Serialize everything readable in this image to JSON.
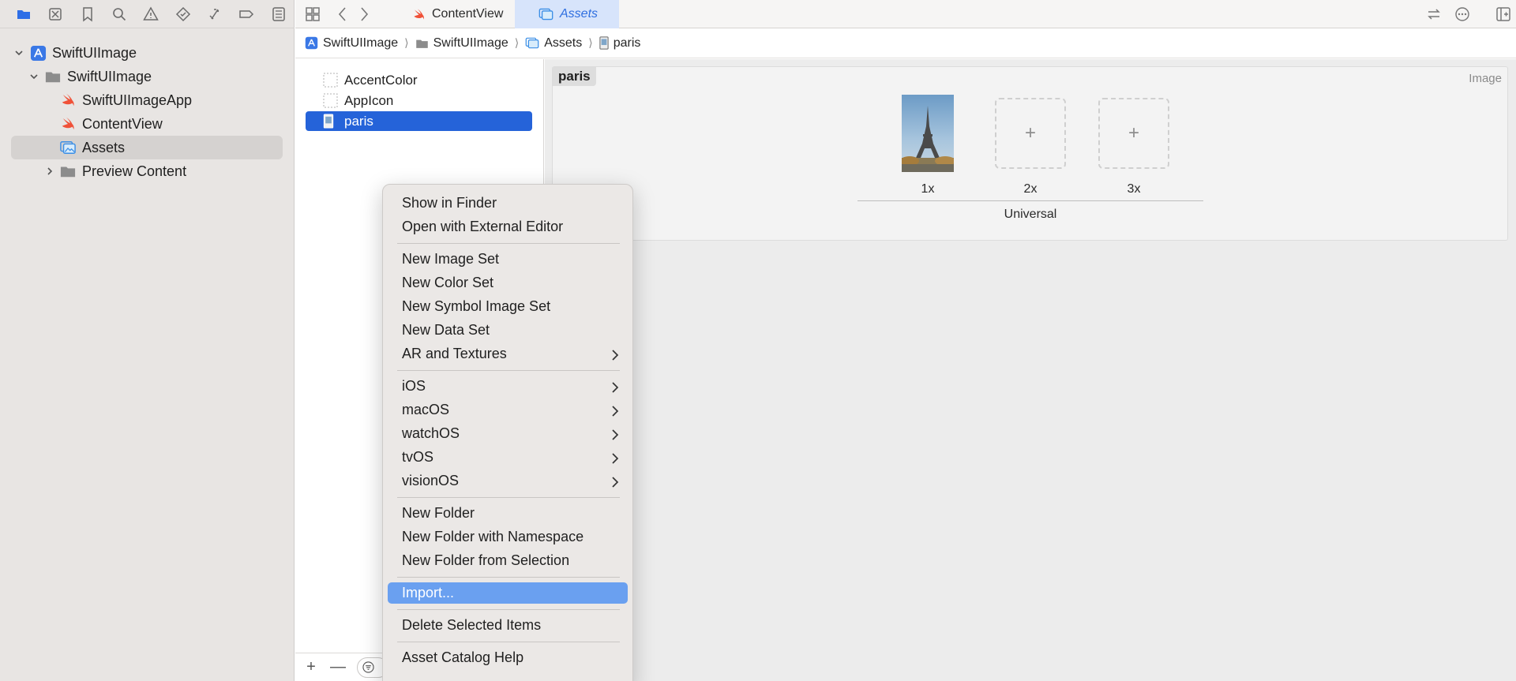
{
  "navigator": {
    "toolbar": [
      "folder-icon",
      "source-control-icon",
      "bookmark-icon",
      "search-icon",
      "warning-icon",
      "test-diamond-icon",
      "debug-icon",
      "breakpoint-icon",
      "report-icon"
    ],
    "tree": [
      {
        "label": "SwiftUIImage",
        "icon": "app-project-icon",
        "level": 0,
        "expanded": true
      },
      {
        "label": "SwiftUIImage",
        "icon": "folder-icon",
        "level": 1,
        "expanded": true
      },
      {
        "label": "SwiftUIImageApp",
        "icon": "swift-icon",
        "level": 2
      },
      {
        "label": "ContentView",
        "icon": "swift-icon",
        "level": 2
      },
      {
        "label": "Assets",
        "icon": "asset-catalog-icon",
        "level": 2,
        "selected": true
      },
      {
        "label": "Preview Content",
        "icon": "folder-icon",
        "level": 2,
        "expanded": false
      }
    ]
  },
  "editor": {
    "tabs": [
      {
        "label": "ContentView",
        "icon": "swift-icon",
        "active": false
      },
      {
        "label": "Assets",
        "icon": "asset-catalog-icon",
        "active": true
      }
    ],
    "breadcrumb": [
      "SwiftUIImage",
      "SwiftUIImage",
      "Assets",
      "paris"
    ]
  },
  "asset_list": {
    "items": [
      {
        "label": "AccentColor",
        "icon": "color-set-icon"
      },
      {
        "label": "AppIcon",
        "icon": "app-icon-set-icon"
      },
      {
        "label": "paris",
        "icon": "image-set-icon",
        "selected": true
      }
    ]
  },
  "detail": {
    "set_name": "paris",
    "set_type": "Image",
    "slots": [
      {
        "label": "1x",
        "filled": true
      },
      {
        "label": "2x",
        "filled": false,
        "placeholder": "+"
      },
      {
        "label": "3x",
        "filled": false,
        "placeholder": "+"
      }
    ],
    "group_label": "Universal"
  },
  "context_menu": {
    "items": [
      {
        "label": "Show in Finder"
      },
      {
        "label": "Open with External Editor"
      },
      {
        "sep": true
      },
      {
        "label": "New Image Set"
      },
      {
        "label": "New Color Set"
      },
      {
        "label": "New Symbol Image Set"
      },
      {
        "label": "New Data Set"
      },
      {
        "label": "AR and Textures",
        "submenu": true
      },
      {
        "sep": true
      },
      {
        "label": "iOS",
        "submenu": true
      },
      {
        "label": "macOS",
        "submenu": true
      },
      {
        "label": "watchOS",
        "submenu": true
      },
      {
        "label": "tvOS",
        "submenu": true
      },
      {
        "label": "visionOS",
        "submenu": true
      },
      {
        "sep": true
      },
      {
        "label": "New Folder"
      },
      {
        "label": "New Folder with Namespace"
      },
      {
        "label": "New Folder from Selection"
      },
      {
        "sep": true
      },
      {
        "label": "Import...",
        "highlighted": true
      },
      {
        "sep": true
      },
      {
        "label": "Delete Selected Items"
      },
      {
        "sep": true
      },
      {
        "label": "Asset Catalog Help"
      }
    ]
  },
  "colors": {
    "accent": "#2563d9",
    "menu_highlight": "#6aa0f0",
    "swift_orange": "#f05138"
  }
}
